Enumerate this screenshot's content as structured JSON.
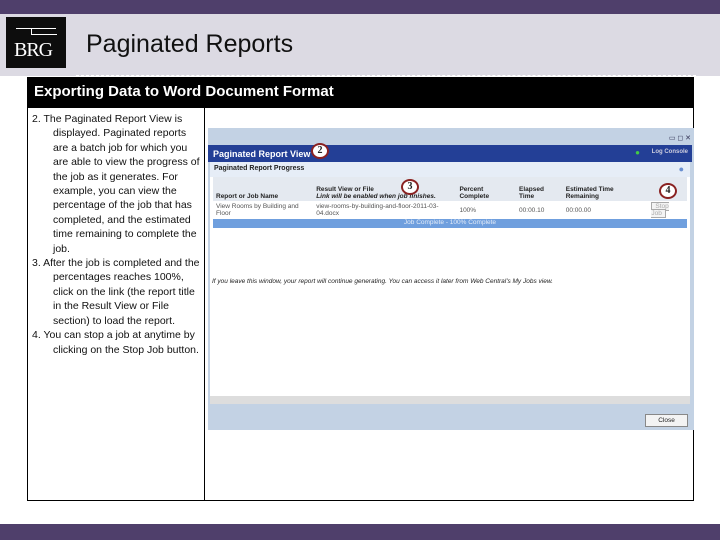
{
  "header": {
    "logo": "BRG",
    "title": "Paginated Reports"
  },
  "section": {
    "title": "Exporting Data to Word Document Format"
  },
  "steps": [
    "2.  The Paginated Report View is displayed. Paginated reports are a batch job for which you are able to view the progress of the job as it generates. For example, you can view the percentage of the job that has completed, and the estimated time remaining to complete the job.",
    "3.  After the job is completed and the percentages reaches 100%, click on the link (the report title in the Result View or File section) to load the report.",
    "4.  You can stop a job at anytime by clicking on the Stop Job button."
  ],
  "screenshot": {
    "window_title": "Paginated Report View",
    "log_console": "Log Console",
    "subtitle": "Paginated Report Progress",
    "columns": [
      "Report or Job Name",
      "Result View or File",
      "Percent Complete",
      "Elapsed Time",
      "Estimated Time Remaining"
    ],
    "result_hint": "Link will be enabled when job finishes.",
    "row": [
      "View Rooms by Building and Floor",
      "view-rooms-by-building-and-floor-2011-03-04.docx",
      "100%",
      "00:00.10",
      "00:00.00"
    ],
    "stop_label": "Stop Job",
    "progress_label": "Job Complete - 100% Complete",
    "progress_percent": 100,
    "note": "If you leave this window, your report will continue generating. You can access it later from Web Central's My Jobs view.",
    "close_label": "Close",
    "callouts": [
      "2",
      "3",
      "4"
    ]
  }
}
